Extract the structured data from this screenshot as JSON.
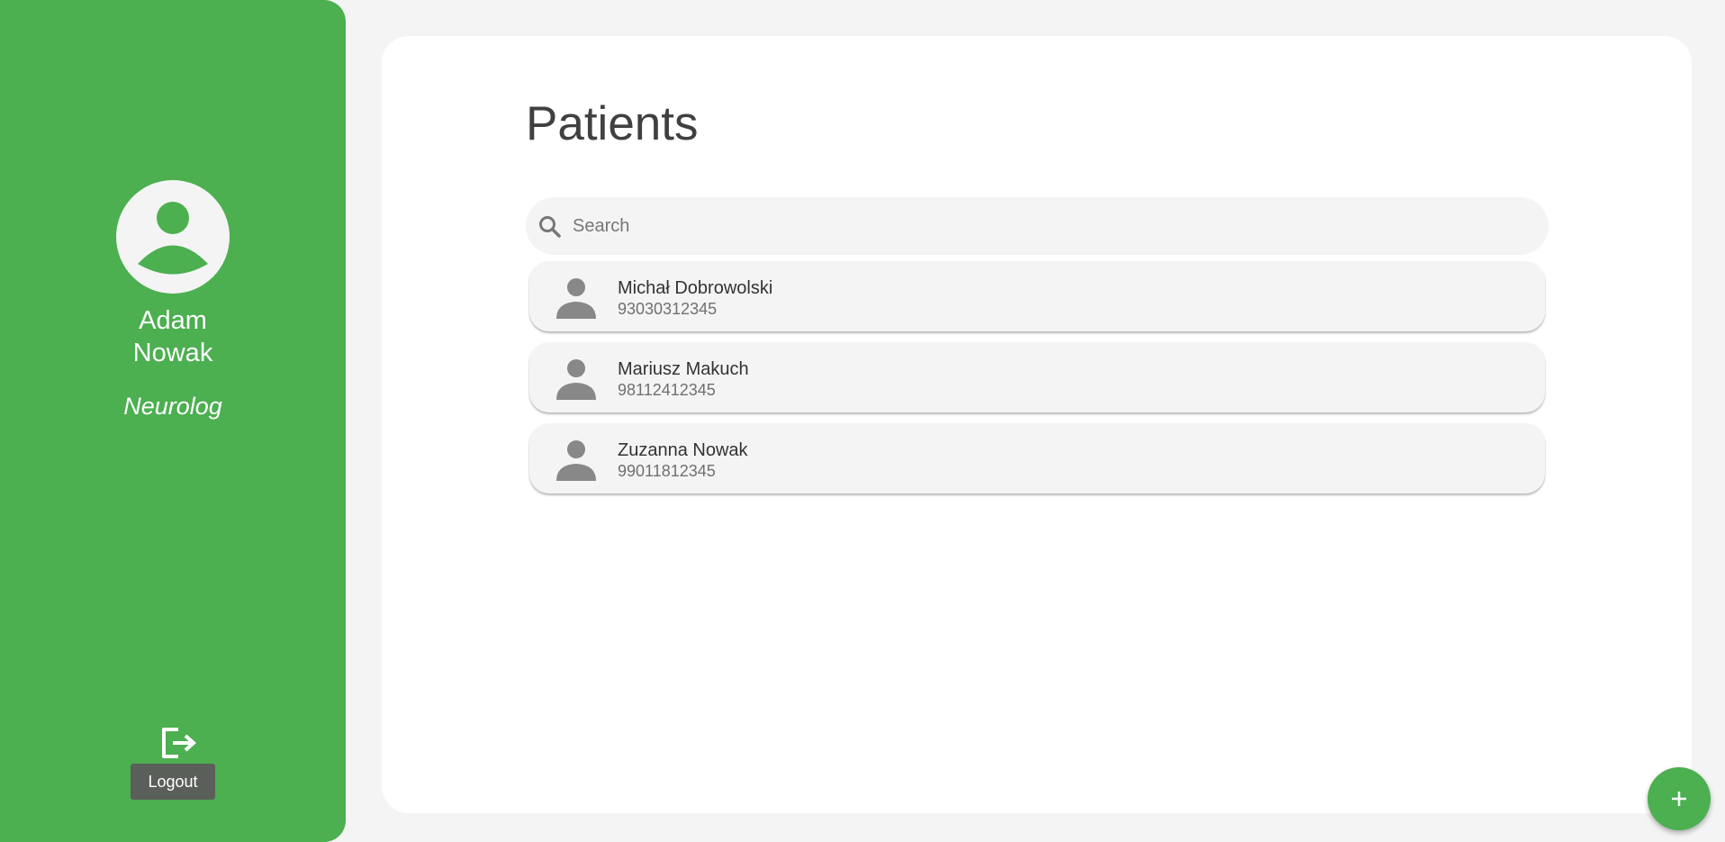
{
  "sidebar": {
    "doctor": {
      "first_name": "Adam",
      "last_name": "Nowak",
      "role": "Neurolog"
    },
    "avatar_icon": "account-circle-icon",
    "logout_icon": "logout-icon",
    "logout_label": "Logout"
  },
  "main": {
    "title": "Patients",
    "search": {
      "placeholder": "Search",
      "value": "",
      "icon": "search-icon"
    },
    "patients": [
      {
        "name": "Michał Dobrowolski",
        "pesel": "93030312345"
      },
      {
        "name": "Mariusz Makuch",
        "pesel": "98112412345"
      },
      {
        "name": "Zuzanna Nowak",
        "pesel": "99011812345"
      }
    ],
    "patient_icon": "person-icon"
  },
  "fab": {
    "icon": "plus-icon"
  },
  "colors": {
    "accent": "#4caf50",
    "background": "#f4f4f4",
    "card": "#ffffff",
    "logout_button": "#5a5f5a",
    "text_primary": "#333333",
    "text_secondary": "#707070"
  }
}
